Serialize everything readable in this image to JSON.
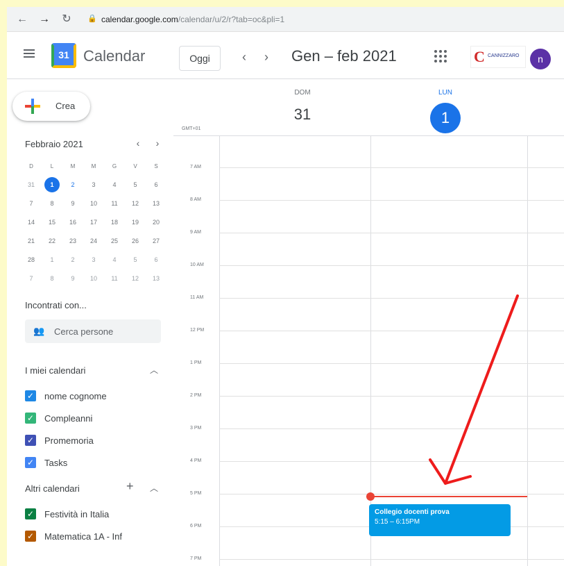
{
  "browser": {
    "url_host": "calendar.google.com",
    "url_path": "/calendar/u/2/r?tab=oc&pli=1"
  },
  "header": {
    "app_title": "Calendar",
    "logo_day": "31",
    "today_label": "Oggi",
    "range_title": "Gen – feb 2021",
    "org_logo_text": "CANNIZZARO",
    "avatar_initial": "n"
  },
  "sidebar": {
    "create_label": "Crea",
    "mini_calendar": {
      "title": "Febbraio 2021",
      "weekday_heads": [
        "D",
        "L",
        "M",
        "M",
        "G",
        "V",
        "S"
      ],
      "weeks": [
        [
          "31",
          "1",
          "2",
          "3",
          "4",
          "5",
          "6"
        ],
        [
          "7",
          "8",
          "9",
          "10",
          "11",
          "12",
          "13"
        ],
        [
          "14",
          "15",
          "16",
          "17",
          "18",
          "19",
          "20"
        ],
        [
          "21",
          "22",
          "23",
          "24",
          "25",
          "26",
          "27"
        ],
        [
          "28",
          "1",
          "2",
          "3",
          "4",
          "5",
          "6"
        ],
        [
          "7",
          "8",
          "9",
          "10",
          "11",
          "12",
          "13"
        ]
      ],
      "selected_day": "1"
    },
    "meet_title": "Incontrati con...",
    "people_search_placeholder": "Cerca persone",
    "my_calendars_title": "I miei calendari",
    "my_calendars": [
      {
        "label": "nome cognome",
        "color": "#1e88e5"
      },
      {
        "label": "Compleanni",
        "color": "#33b679"
      },
      {
        "label": "Promemoria",
        "color": "#3f51b5"
      },
      {
        "label": "Tasks",
        "color": "#4285f4"
      }
    ],
    "other_calendars_title": "Altri calendari",
    "other_calendars": [
      {
        "label": "Festività in Italia",
        "color": "#0b8043"
      },
      {
        "label": "Matematica 1A - Inf",
        "color": "#b35900"
      }
    ]
  },
  "main": {
    "timezone": "GMT+01",
    "days": [
      {
        "dow": "DOM",
        "num": "31"
      },
      {
        "dow": "LUN",
        "num": "1"
      }
    ],
    "hours": [
      "7 AM",
      "8 AM",
      "9 AM",
      "10 AM",
      "11 AM",
      "12 PM",
      "1 PM",
      "2 PM",
      "3 PM",
      "4 PM",
      "5 PM",
      "6 PM",
      "7 PM"
    ],
    "event": {
      "title": "Collegio docenti prova",
      "time": "5:15 – 6:15PM",
      "color": "#039be5"
    }
  },
  "colors": {
    "accent": "#1a73e8",
    "annotation_arrow": "#ee1c1c",
    "now_line": "#ea4335"
  }
}
